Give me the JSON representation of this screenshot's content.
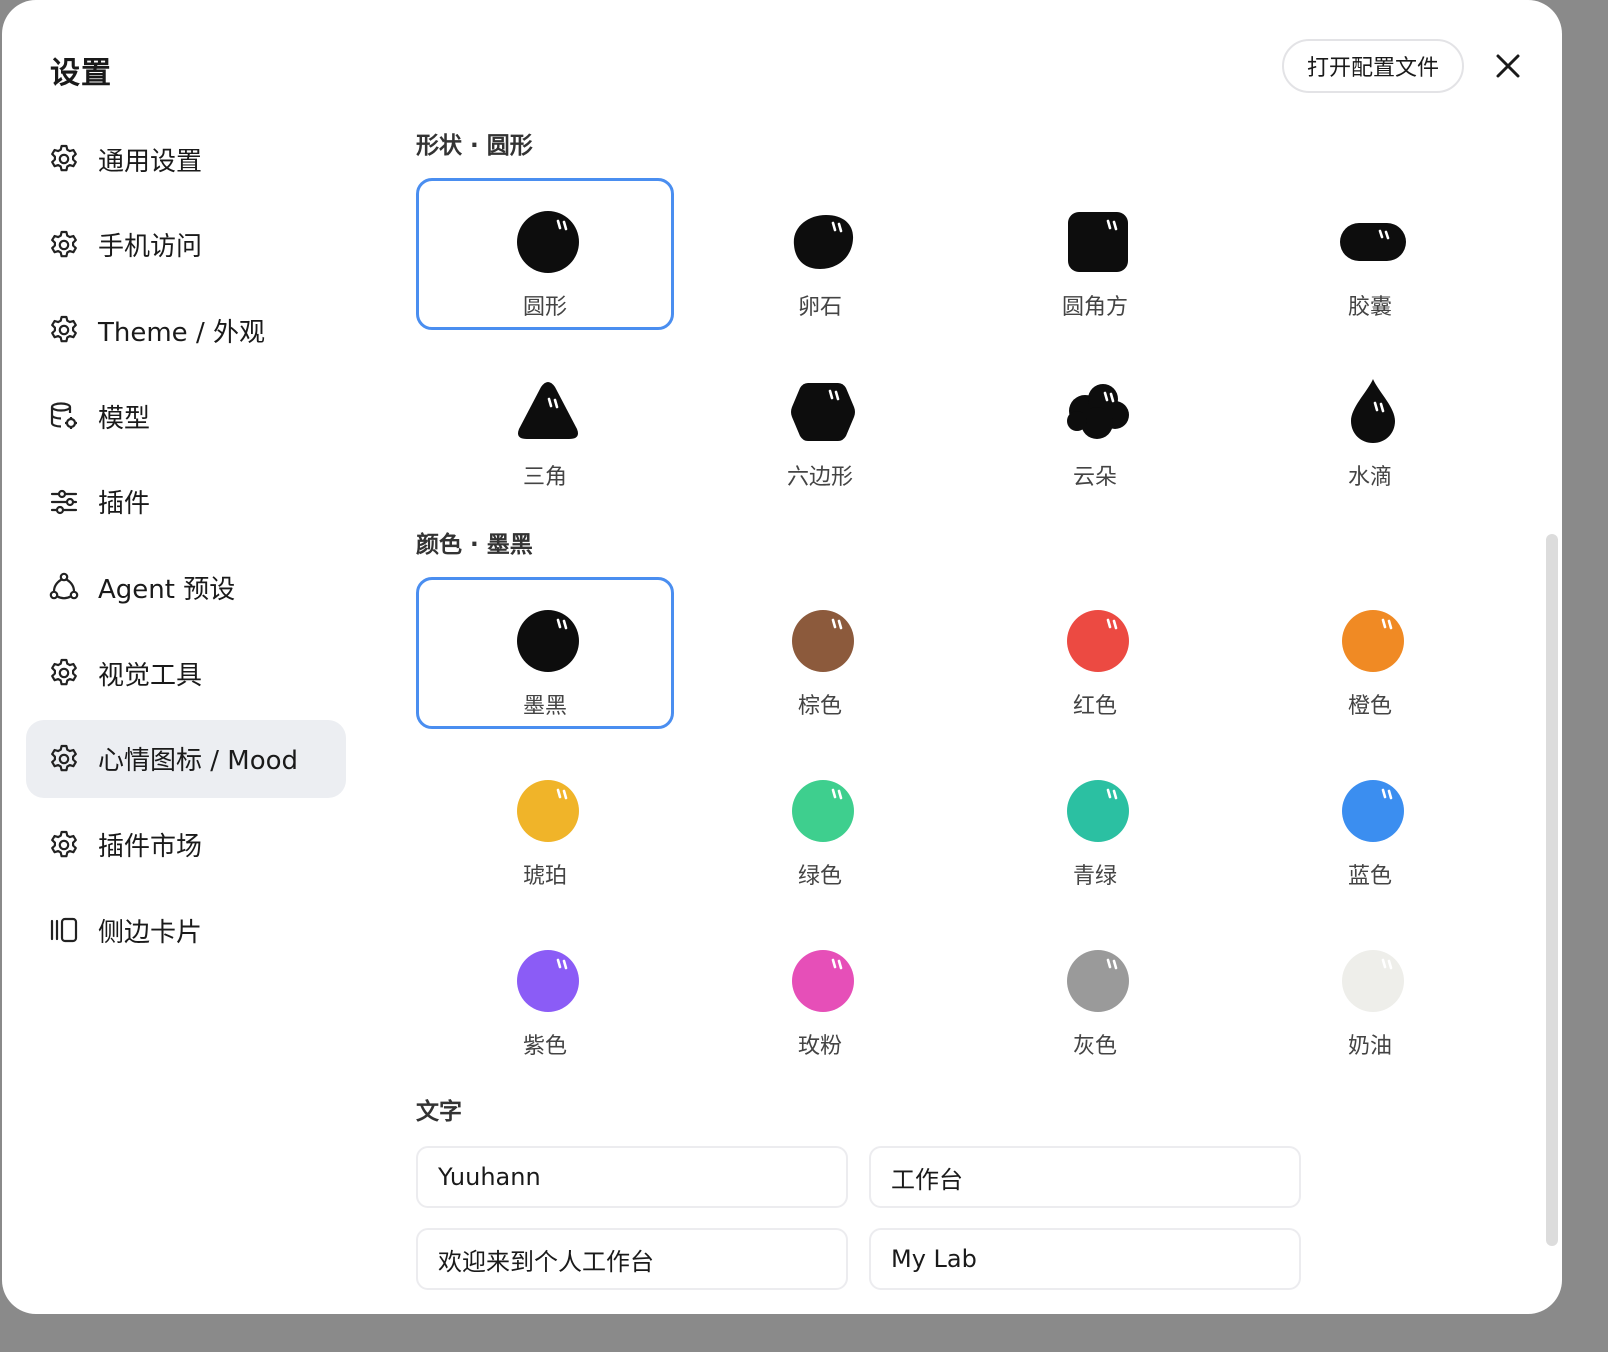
{
  "header": {
    "title": "设置",
    "open_config_label": "打开配置文件"
  },
  "sidebar": {
    "items": [
      {
        "label": "通用设置",
        "icon": "gear-icon"
      },
      {
        "label": "手机访问",
        "icon": "gear-icon"
      },
      {
        "label": "Theme / 外观",
        "icon": "gear-icon"
      },
      {
        "label": "模型",
        "icon": "database-gear-icon"
      },
      {
        "label": "插件",
        "icon": "sliders-icon"
      },
      {
        "label": "Agent 预设",
        "icon": "network-icon"
      },
      {
        "label": "视觉工具",
        "icon": "gear-icon"
      },
      {
        "label": "心情图标 / Mood",
        "icon": "gear-icon",
        "active": true
      },
      {
        "label": "插件市场",
        "icon": "gear-icon"
      },
      {
        "label": "侧边卡片",
        "icon": "side-cards-icon"
      }
    ]
  },
  "shape_section": {
    "title": "形状 · 圆形",
    "options": [
      {
        "label": "圆形",
        "icon": "circle-shape-icon",
        "selected": true
      },
      {
        "label": "卵石",
        "icon": "pebble-shape-icon"
      },
      {
        "label": "圆角方",
        "icon": "rounded-square-shape-icon"
      },
      {
        "label": "胶囊",
        "icon": "capsule-shape-icon"
      },
      {
        "label": "三角",
        "icon": "triangle-shape-icon"
      },
      {
        "label": "六边形",
        "icon": "hexagon-shape-icon"
      },
      {
        "label": "云朵",
        "icon": "cloud-shape-icon"
      },
      {
        "label": "水滴",
        "icon": "drop-shape-icon"
      }
    ]
  },
  "color_section": {
    "title": "颜色 · 墨黑",
    "options": [
      {
        "label": "墨黑",
        "color": "#0d0d0d",
        "selected": true
      },
      {
        "label": "棕色",
        "color": "#8c5a3c"
      },
      {
        "label": "红色",
        "color": "#ec4a42"
      },
      {
        "label": "橙色",
        "color": "#f08a24"
      },
      {
        "label": "琥珀",
        "color": "#f0b429"
      },
      {
        "label": "绿色",
        "color": "#3ecf8e"
      },
      {
        "label": "青绿",
        "color": "#2bc0a2"
      },
      {
        "label": "蓝色",
        "color": "#3b8ef0"
      },
      {
        "label": "紫色",
        "color": "#8b5cf6"
      },
      {
        "label": "玫粉",
        "color": "#e64fb8"
      },
      {
        "label": "灰色",
        "color": "#9a9a9a"
      },
      {
        "label": "奶油",
        "color": "#eeeeea"
      }
    ]
  },
  "text_section": {
    "title": "文字",
    "fields": [
      {
        "value": "Yuuhann"
      },
      {
        "value": "工作台"
      },
      {
        "value": "欢迎来到个人工作台"
      },
      {
        "value": "My Lab"
      }
    ]
  },
  "colors": {
    "accent": "#4a8ef0",
    "active_bg": "#eceef2"
  }
}
